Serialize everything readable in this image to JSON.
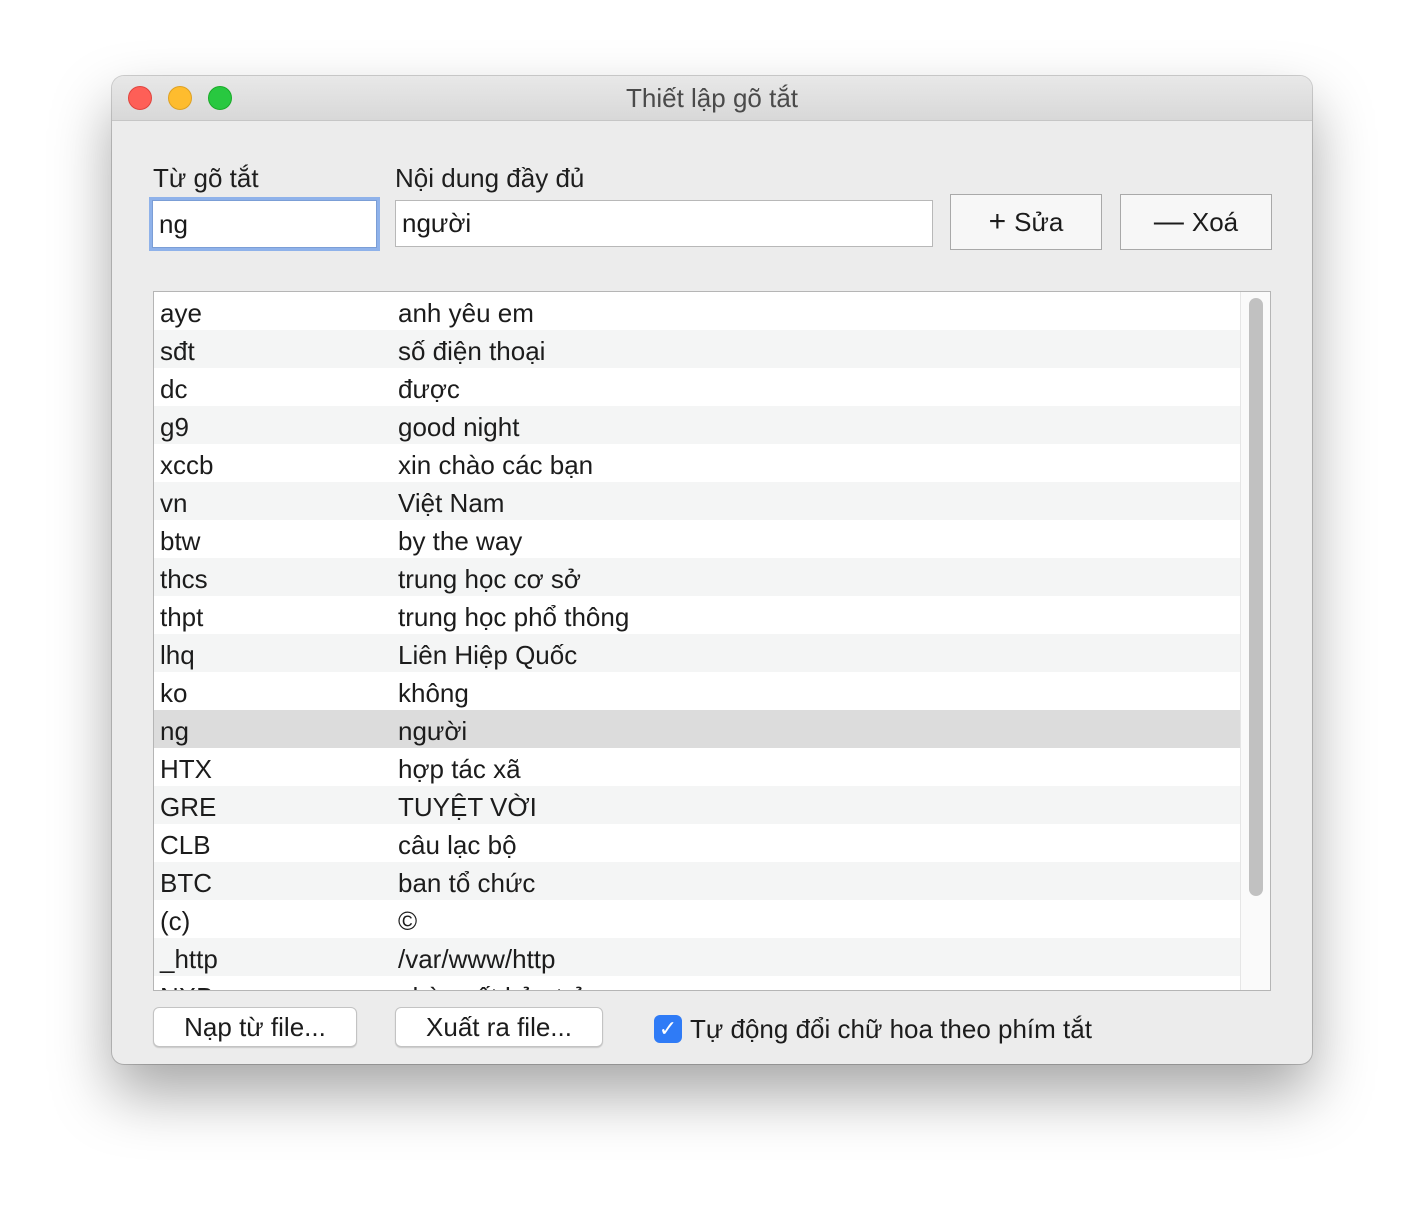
{
  "window": {
    "title": "Thiết lập gõ tắt"
  },
  "form": {
    "shortcut_label": "Từ gõ tắt",
    "content_label": "Nội dung đầy đủ",
    "shortcut_value": "ng",
    "content_value": "người",
    "edit_button": "Sửa",
    "delete_button": "Xoá"
  },
  "table": {
    "selected_index": 11,
    "rows": [
      {
        "short": "aye",
        "full": "anh yêu em"
      },
      {
        "short": "sđt",
        "full": "số điện thoại"
      },
      {
        "short": "dc",
        "full": "được"
      },
      {
        "short": "g9",
        "full": "good night"
      },
      {
        "short": "xccb",
        "full": "xin chào các bạn"
      },
      {
        "short": "vn",
        "full": "Việt Nam"
      },
      {
        "short": "btw",
        "full": "by the way"
      },
      {
        "short": "thcs",
        "full": "trung học cơ sở"
      },
      {
        "short": "thpt",
        "full": "trung học phổ thông"
      },
      {
        "short": "lhq",
        "full": "Liên Hiệp Quốc"
      },
      {
        "short": "ko",
        "full": "không"
      },
      {
        "short": "ng",
        "full": "người"
      },
      {
        "short": "HTX",
        "full": "hợp tác xã"
      },
      {
        "short": "GRE",
        "full": "TUYỆT VỜI"
      },
      {
        "short": "CLB",
        "full": "câu lạc bộ"
      },
      {
        "short": "BTC",
        "full": "ban tổ chức"
      },
      {
        "short": "(c)",
        "full": "©"
      },
      {
        "short": "_http",
        "full": "/var/www/http"
      },
      {
        "short": "NXB",
        "full": "nhà xuất bản trẻ"
      }
    ]
  },
  "footer": {
    "import_button": "Nạp từ file...",
    "export_button": "Xuất ra file...",
    "auto_caps_label": "Tự động đổi chữ hoa theo phím tắt",
    "auto_caps_checked": true
  }
}
